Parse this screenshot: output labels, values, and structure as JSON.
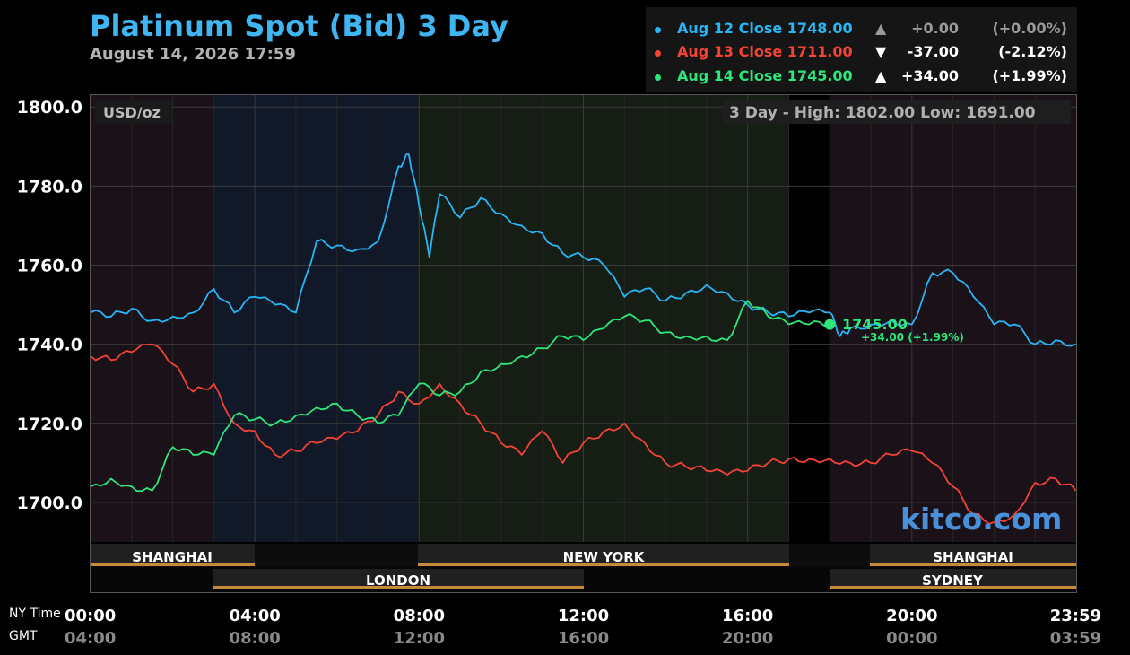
{
  "header": {
    "title": "Platinum Spot (Bid) 3 Day",
    "subtitle": "August 14, 2026 17:59"
  },
  "legend": [
    {
      "label": "Aug 12 Close 1748.00",
      "arrow": "▲",
      "change": "+0.00",
      "percent": "(+0.00%)",
      "color": "#29b6f6",
      "muted": true
    },
    {
      "label": "Aug 13 Close 1711.00",
      "arrow": "▼",
      "change": "-37.00",
      "percent": "(-2.12%)",
      "color": "#f44336",
      "muted": false
    },
    {
      "label": "Aug 14 Close 1745.00",
      "arrow": "▲",
      "change": "+34.00",
      "percent": "(+1.99%)",
      "color": "#2ee67a",
      "muted": false
    }
  ],
  "plot": {
    "unit_label": "USD/oz",
    "range_text": "3 Day - High: 1802.00  Low: 1691.00",
    "current_price": "1745.00",
    "current_change": "+34.00 (+1.99%)",
    "watermark": "kitco.com"
  },
  "axis_captions": {
    "ny": "NY Time",
    "gmt": "GMT"
  },
  "sessions": {
    "top_row": [
      "SHANGHAI",
      "NEW YORK",
      "SHANGHAI"
    ],
    "bottom_row": [
      "LONDON",
      "SYDNEY"
    ]
  },
  "chart_data": {
    "type": "line",
    "title": "Platinum Spot (Bid) 3 Day",
    "ylabel": "USD/oz",
    "ylim": [
      1690,
      1803
    ],
    "yticks": [
      "1800.0",
      "1780.0",
      "1760.0",
      "1740.0",
      "1720.0",
      "1700.0"
    ],
    "xlim": [
      0,
      24
    ],
    "xticks_ny": [
      "00:00",
      "04:00",
      "08:00",
      "12:00",
      "16:00",
      "20:00",
      "23:59"
    ],
    "xticks_gmt": [
      "04:00",
      "08:00",
      "12:00",
      "16:00",
      "20:00",
      "00:00",
      "03:59"
    ],
    "grid": true,
    "legend_position": "top-right",
    "series": [
      {
        "name": "Aug 12",
        "color": "#29b6f6",
        "x": [
          0,
          0.5,
          1,
          1.5,
          2,
          2.5,
          3,
          3.5,
          4,
          4.5,
          5,
          5.5,
          6,
          6.5,
          7,
          7.5,
          7.75,
          8,
          8.25,
          8.5,
          9,
          9.5,
          10,
          10.5,
          11,
          11.5,
          12,
          12.5,
          13,
          13.5,
          14,
          14.5,
          15,
          15.5,
          16,
          16.5,
          17,
          17.5,
          18,
          18.25,
          18.5,
          19,
          19.5,
          20,
          20.5,
          21,
          21.5,
          22,
          22.5,
          23,
          23.5,
          23.99
        ],
        "y": [
          1748,
          1747,
          1749,
          1746,
          1747,
          1748,
          1754,
          1748,
          1752,
          1750,
          1748,
          1766,
          1765,
          1764,
          1766,
          1785,
          1788,
          1775,
          1762,
          1778,
          1772,
          1777,
          1773,
          1770,
          1768,
          1763,
          1762,
          1760,
          1752,
          1754,
          1751,
          1753,
          1755,
          1753,
          1750,
          1748,
          1747,
          1748,
          1748,
          1742,
          1744,
          1745,
          1746,
          1745,
          1758,
          1758,
          1752,
          1745,
          1745,
          1740,
          1741,
          1740
        ]
      },
      {
        "name": "Aug 13",
        "color": "#f44336",
        "x": [
          0,
          0.5,
          1,
          1.5,
          2,
          2.5,
          3,
          3.5,
          4,
          4.5,
          5,
          5.5,
          6,
          6.5,
          7,
          7.5,
          8,
          8.5,
          9,
          9.5,
          10,
          10.5,
          11,
          11.5,
          12,
          12.5,
          13,
          13.5,
          14,
          14.5,
          15,
          15.5,
          16,
          16.5,
          17,
          17.5,
          18,
          18.5,
          19,
          19.5,
          20,
          20.5,
          21,
          21.5,
          22,
          22.5,
          23,
          23.5,
          23.99
        ],
        "y": [
          1737,
          1736,
          1738,
          1740,
          1735,
          1728,
          1730,
          1720,
          1718,
          1712,
          1713,
          1715,
          1716,
          1718,
          1722,
          1728,
          1725,
          1730,
          1725,
          1720,
          1715,
          1712,
          1718,
          1710,
          1715,
          1718,
          1720,
          1715,
          1710,
          1709,
          1708,
          1707,
          1708,
          1710,
          1711,
          1711,
          1711,
          1710,
          1710,
          1712,
          1713,
          1710,
          1704,
          1697,
          1695,
          1697,
          1705,
          1706,
          1703
        ]
      },
      {
        "name": "Aug 14",
        "color": "#2ee67a",
        "x": [
          0,
          0.5,
          1,
          1.5,
          2,
          2.5,
          3,
          3.5,
          4,
          4.5,
          5,
          5.5,
          6,
          6.5,
          7,
          7.5,
          8,
          8.5,
          9,
          9.5,
          10,
          10.5,
          11,
          11.5,
          12,
          12.5,
          13,
          13.5,
          14,
          14.5,
          15,
          15.5,
          16,
          16.5,
          17,
          17.5,
          18
        ],
        "y": [
          1704,
          1706,
          1704,
          1703,
          1714,
          1712,
          1712,
          1722,
          1721,
          1720,
          1722,
          1724,
          1725,
          1722,
          1720,
          1722,
          1730,
          1727,
          1728,
          1733,
          1735,
          1737,
          1739,
          1742,
          1741,
          1744,
          1747,
          1746,
          1743,
          1742,
          1742,
          1741,
          1751,
          1747,
          1745,
          1745,
          1745
        ]
      }
    ]
  }
}
